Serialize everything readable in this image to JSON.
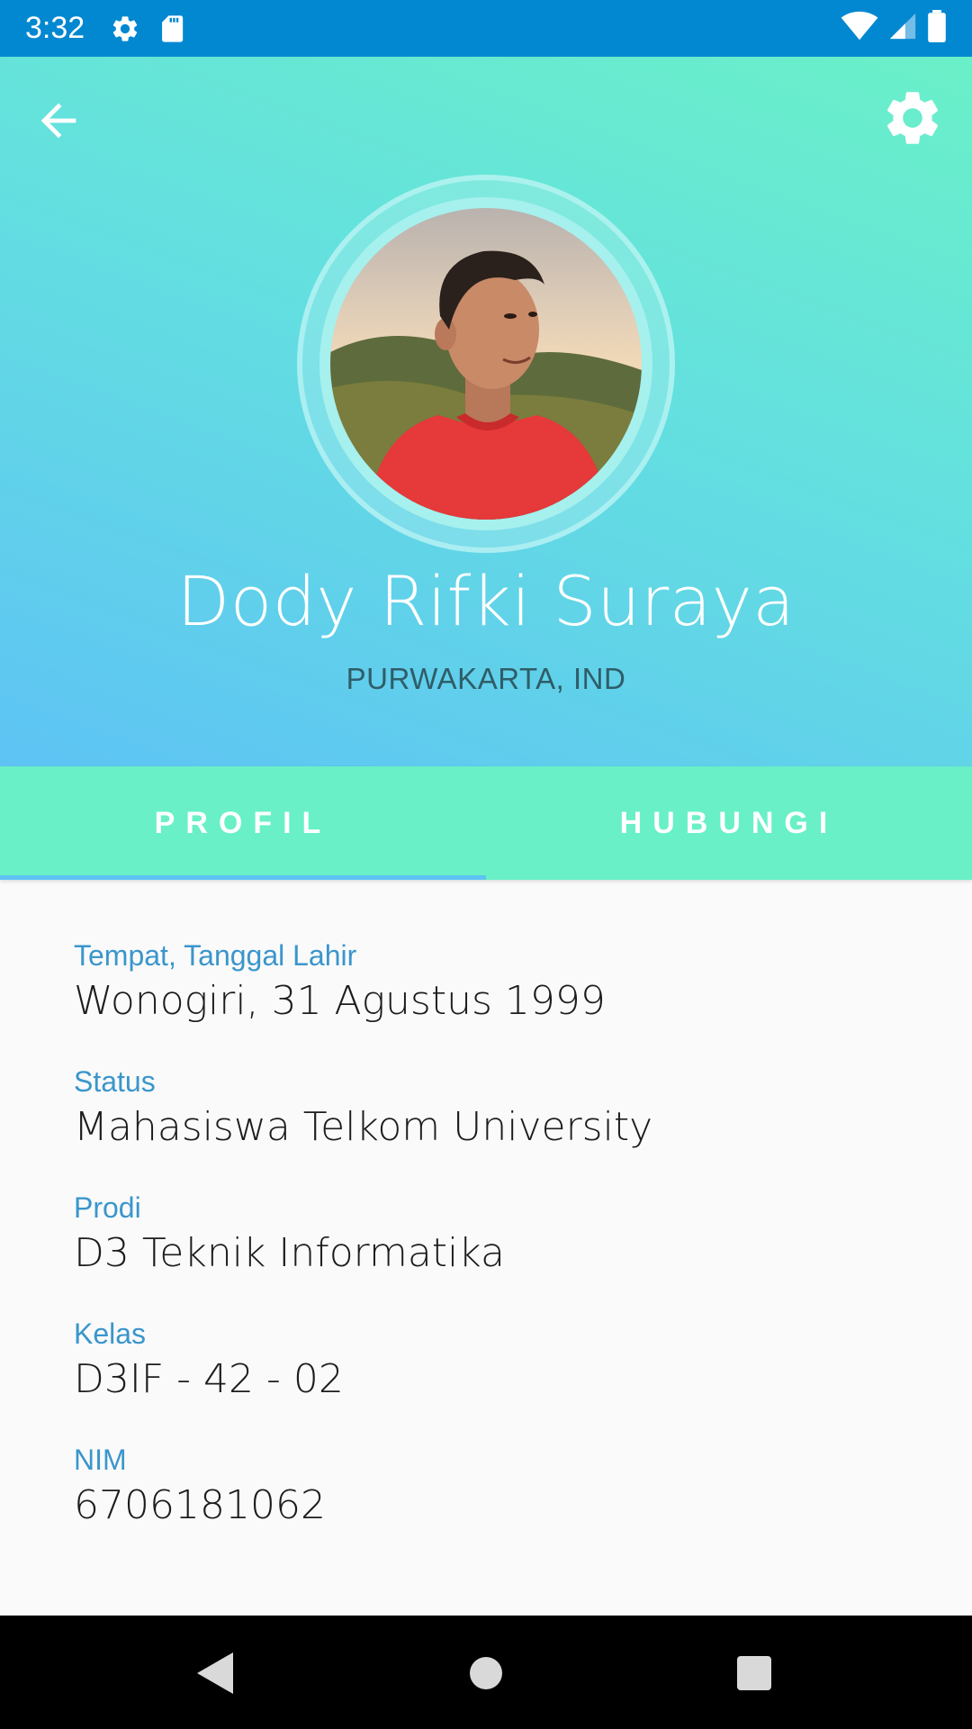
{
  "status_bar": {
    "time": "3:32",
    "icons_left": [
      "settings-icon",
      "sd-card-icon"
    ],
    "icons_right": [
      "wifi-icon",
      "signal-icon",
      "battery-icon"
    ],
    "background": "#0288d1"
  },
  "header": {
    "back_icon": "arrow-back-icon",
    "settings_icon": "settings-gear-icon",
    "name": "Dody Rifki Suraya",
    "location": "PURWAKARTA, IND",
    "gradient_colors": [
      "#6af0c8",
      "#5ec3f4"
    ]
  },
  "tabs": [
    {
      "label": "PROFIL",
      "selected": true
    },
    {
      "label": "HUBUNGI",
      "selected": false
    }
  ],
  "profile_fields": [
    {
      "label": "Tempat, Tanggal Lahir",
      "value": "Wonogiri, 31 Agustus 1999"
    },
    {
      "label": "Status",
      "value": "Mahasiswa Telkom University"
    },
    {
      "label": "Prodi",
      "value": "D3 Teknik Informatika"
    },
    {
      "label": "Kelas",
      "value": "D3IF - 42 - 02"
    },
    {
      "label": "NIM",
      "value": "6706181062"
    }
  ],
  "nav_bar": {
    "icons": [
      "nav-back-icon",
      "nav-home-icon",
      "nav-recents-icon"
    ]
  },
  "colors": {
    "accent": "#69f0c6",
    "label": "#3a96cc",
    "indicator": "#5ec3f4"
  }
}
